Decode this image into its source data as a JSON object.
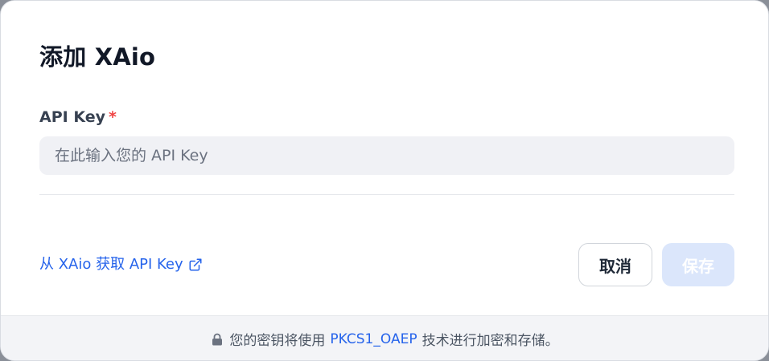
{
  "dialog": {
    "title": "添加 XAio",
    "field": {
      "label": "API Key",
      "required_mark": "*",
      "placeholder": "在此输入您的 API Key",
      "value": ""
    },
    "get_key_link": "从 XAio 获取 API Key",
    "buttons": {
      "cancel": "取消",
      "save": "保存"
    },
    "footer": {
      "text_before": "您的密钥将使用",
      "highlight": "PKCS1_OAEP",
      "text_after": "技术进行加密和存储。"
    },
    "colors": {
      "accent": "#2563eb",
      "required": "#ef4444",
      "save_disabled_bg": "#dbe6fb"
    },
    "icons": {
      "link": "external-link-icon",
      "footer": "lock-icon"
    }
  }
}
